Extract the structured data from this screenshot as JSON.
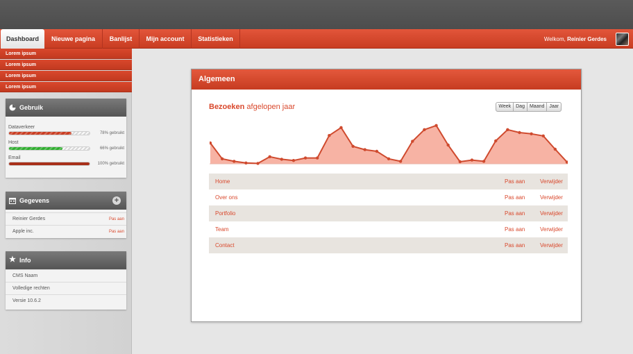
{
  "nav": {
    "tabs": [
      {
        "label": "Dashboard"
      },
      {
        "label": "Nieuwe pagina"
      },
      {
        "label": "Banlijst"
      },
      {
        "label": "Mijn account"
      },
      {
        "label": "Statistieken"
      }
    ],
    "welcome_prefix": "Welkom,",
    "welcome_name": "Reinier Gerdes"
  },
  "sidebar": {
    "links": [
      "Lorem ipsum",
      "Lorem ipsum",
      "Lorem ipsum",
      "Lorem ipsum"
    ],
    "usage": {
      "title": "Gebruik",
      "icon": "pie-chart-icon",
      "items": [
        {
          "label": "Dataverkeer",
          "percent": 78,
          "text": "78% gebruikt",
          "color": "#c93d22"
        },
        {
          "label": "Host",
          "percent": 66,
          "text": "66% gebruikt",
          "color": "#2fae2f"
        },
        {
          "label": "Email",
          "percent": 100,
          "text": "100% gebruikt",
          "color": "#a8301a"
        }
      ]
    },
    "gegevens": {
      "title": "Gegevens",
      "icon": "calendar-icon",
      "add_icon": "+",
      "rows": [
        {
          "label": "Reinier Gerdes",
          "edit": "Pas aan"
        },
        {
          "label": "Apple inc.",
          "edit": "Pas aan"
        }
      ]
    },
    "info": {
      "title": "Info",
      "icon": "star-icon",
      "rows": [
        "CMS Naam",
        "Volledige rechten",
        "Versie 10.6.2"
      ]
    }
  },
  "main": {
    "title": "Algemeen",
    "chart_title_bold": "Bezoeken",
    "chart_title_rest": "afgelopen jaar",
    "ranges": [
      "Week",
      "Dag",
      "Maand",
      "Jaar"
    ],
    "colors": {
      "accent": "#d9482c",
      "fill": "#f7b3a4",
      "line": "#cf4a2e"
    },
    "pages": [
      {
        "name": "Home",
        "edit": "Pas aan",
        "delete": "Verwijder"
      },
      {
        "name": "Over ons",
        "edit": "Pas aan",
        "delete": "Verwijder"
      },
      {
        "name": "Portfolio",
        "edit": "Pas aan",
        "delete": "Verwijder"
      },
      {
        "name": "Team",
        "edit": "Pas aan",
        "delete": "Verwijder"
      },
      {
        "name": "Contact",
        "edit": "Pas aan",
        "delete": "Verwijder"
      }
    ]
  },
  "chart_data": {
    "type": "area",
    "title": "Bezoeken afgelopen jaar",
    "xlabel": "",
    "ylabel": "",
    "grid": false,
    "x": [
      0,
      1,
      2,
      3,
      4,
      5,
      6,
      7,
      8,
      9,
      10,
      11,
      12,
      13,
      14,
      15,
      16,
      17,
      18,
      19,
      20,
      21,
      22,
      23,
      24,
      25,
      26,
      27,
      28,
      29,
      30
    ],
    "values": [
      50,
      12,
      6,
      2,
      1,
      17,
      11,
      8,
      14,
      14,
      68,
      87,
      42,
      34,
      30,
      12,
      6,
      54,
      82,
      92,
      45,
      5,
      9,
      6,
      55,
      82,
      75,
      72,
      67,
      35,
      4
    ],
    "ylim": [
      0,
      100
    ]
  }
}
